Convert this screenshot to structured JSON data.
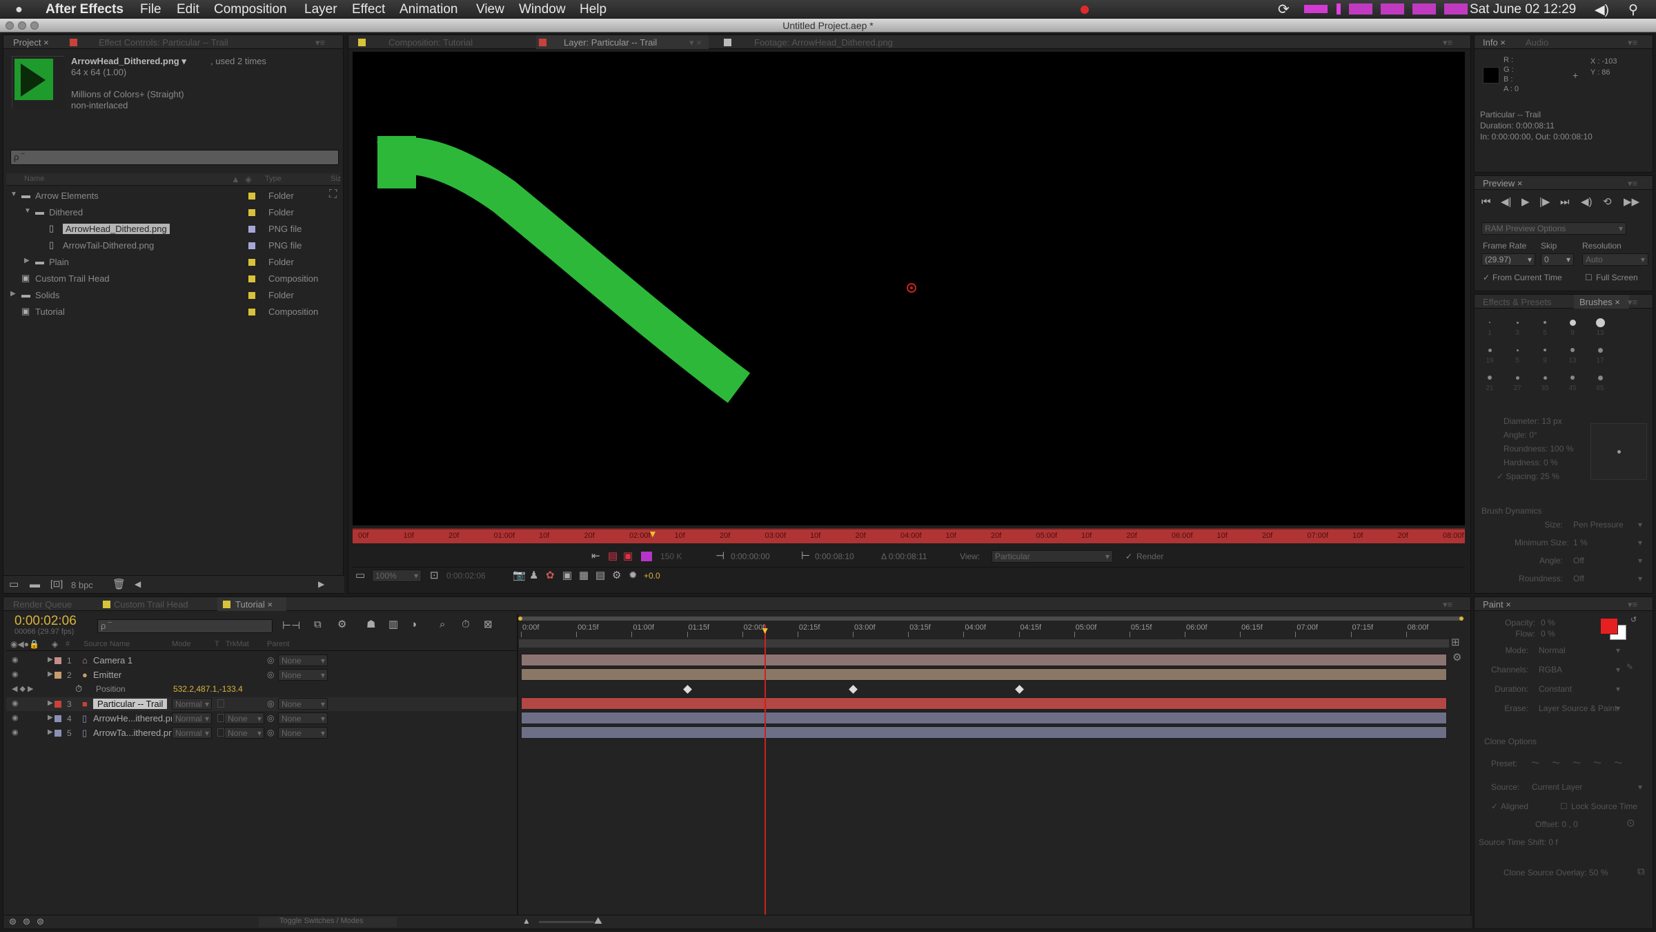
{
  "menubar": {
    "app_name": "After Effects",
    "items": [
      "File",
      "Edit",
      "Composition",
      "Layer",
      "Effect",
      "Animation",
      "View",
      "Window",
      "Help"
    ],
    "clock": "Sat June 02 12:29"
  },
  "window": {
    "title": "Untitled Project.aep *"
  },
  "project_panel": {
    "tabs": [
      "Project ×",
      "Effect Controls: Particular -- Trail"
    ],
    "footage_name": "ArrowHead_Dithered.png ▾",
    "used": ", used 2 times",
    "dims": "64 x 64 (1.00)",
    "colors": "Millions of Colors+ (Straight)",
    "interlace": "non-interlaced",
    "search_placeholder": "ρ ‾",
    "col_name": "Name",
    "col_type": "Type",
    "col_size": "Siz",
    "items": [
      {
        "name": "Arrow Elements",
        "type": "Folder",
        "color": "#d8c23a",
        "indent": 0,
        "twirl": "▼",
        "icon": "folder-icon"
      },
      {
        "name": "Dithered",
        "type": "Folder",
        "color": "#d8c23a",
        "indent": 1,
        "twirl": "▼",
        "icon": "folder-icon"
      },
      {
        "name": "ArrowHead_Dithered.png",
        "type": "PNG file",
        "color": "#a5a6d8",
        "indent": 2,
        "twirl": "",
        "icon": "file-icon",
        "selected": true
      },
      {
        "name": "ArrowTail-Dithered.png",
        "type": "PNG file",
        "color": "#a5a6d8",
        "indent": 2,
        "twirl": "",
        "icon": "file-icon"
      },
      {
        "name": "Plain",
        "type": "Folder",
        "color": "#d8c23a",
        "indent": 1,
        "twirl": "▶",
        "icon": "folder-icon"
      },
      {
        "name": "Custom Trail Head",
        "type": "Composition",
        "color": "#d8c23a",
        "indent": 0,
        "twirl": "",
        "icon": "composition-icon"
      },
      {
        "name": "Solids",
        "type": "Folder",
        "color": "#d8c23a",
        "indent": 0,
        "twirl": "▶",
        "icon": "folder-icon"
      },
      {
        "name": "Tutorial",
        "type": "Composition",
        "color": "#d8c23a",
        "indent": 0,
        "twirl": "",
        "icon": "composition-icon"
      }
    ],
    "bpc": "8 bpc"
  },
  "viewer": {
    "tabs": [
      "Composition: Tutorial",
      "Layer: Particular -- Trail",
      "Footage: ArrowHead_Dithered.png"
    ],
    "mini_ticks": [
      "00f",
      "10f",
      "20f",
      "01:00f",
      "10f",
      "20f",
      "02:00f",
      "10f",
      "20f",
      "03:00f",
      "10f",
      "20f",
      "04:00f",
      "10f",
      "20f",
      "05:00f",
      "10f",
      "20f",
      "06:00f",
      "10f",
      "20f",
      "07:00f",
      "10f",
      "20f",
      "08:00f"
    ],
    "controls": {
      "zoom": "100%",
      "timecode": "0:00:02:06",
      "in_time": "0:00:00:00",
      "out_time": "0:00:08:10",
      "duration": "Δ 0:00:08:11",
      "view_label": "View:",
      "view_value": "Particular",
      "render_label": "Render",
      "exposure": "+0.0",
      "channel": "150 K"
    }
  },
  "info_panel": {
    "tabs": [
      "Info ×",
      "Audio"
    ],
    "rgba": [
      "R :",
      "G :",
      "B :",
      "A : 0"
    ],
    "coords": [
      "X : -103",
      "Y : 86"
    ],
    "layer": "Particular -- Trail",
    "duration": "Duration: 0:00:08:11",
    "inout": "In: 0:00:00:00, Out: 0:00:08:10"
  },
  "preview_panel": {
    "tab": "Preview ×",
    "ram_options": "RAM Preview Options",
    "frame_rate_label": "Frame Rate",
    "skip_label": "Skip",
    "resolution_label": "Resolution",
    "frame_rate": "(29.97)",
    "skip": "0",
    "resolution": "Auto",
    "from_current": "From Current Time",
    "full_screen": "Full Screen"
  },
  "brushes_panel": {
    "tabs": [
      "Effects & Presets",
      "Brushes ×"
    ],
    "brush_sizes": [
      "1",
      "3",
      "5",
      "9",
      "13",
      "19",
      "5",
      "9",
      "13",
      "17",
      "21",
      "27",
      "35",
      "45",
      "65"
    ],
    "props": [
      "Diameter: 13 px",
      "Angle: 0°",
      "Roundness: 100 %",
      "Hardness: 0 %",
      "Spacing: 25 %"
    ],
    "dynamics": "Brush Dynamics",
    "dyn_rows": [
      [
        "Size:",
        "Pen Pressure"
      ],
      [
        "Minimum Size:",
        "1 %"
      ],
      [
        "Angle:",
        "Off"
      ],
      [
        "Roundness:",
        "Off"
      ]
    ]
  },
  "paint_panel": {
    "tab": "Paint ×",
    "fg_color": "#e62020",
    "rows": [
      [
        "Opacity:",
        "0 %"
      ],
      [
        "Flow:",
        "0 %"
      ],
      [
        "Mode:",
        "Normal"
      ],
      [
        "Channels:",
        "RGBA"
      ],
      [
        "Duration:",
        "Constant"
      ],
      [
        "Erase:",
        "Layer Source & Paint"
      ]
    ],
    "clone_options": "Clone Options",
    "preset": "Preset:",
    "source": "Source:",
    "source_value": "Current Layer",
    "aligned": "Aligned",
    "lock_source": "Lock Source Time",
    "offset": "Offset: 0 , 0",
    "source_time_shift": "Source Time Shift: 0 f",
    "clone_overlay": "Clone Source Overlay: 50 %"
  },
  "timeline": {
    "tabs": [
      "Render Queue",
      "Custom Trail Head",
      "Tutorial ×"
    ],
    "timecode": "0:00:02:06",
    "fps": "00066 (29.97 fps)",
    "col_source": "Source Name",
    "col_mode": "Mode",
    "col_t": "T",
    "col_trkmat": "TrkMat",
    "col_parent": "Parent",
    "ruler": [
      "0:00f",
      "00:15f",
      "01:00f",
      "01:15f",
      "02:00f",
      "02:15f",
      "03:00f",
      "03:15f",
      "04:00f",
      "04:15f",
      "05:00f",
      "05:15f",
      "06:00f",
      "06:15f",
      "07:00f",
      "07:15f",
      "08:00f"
    ],
    "layers": [
      {
        "num": "1",
        "name": "Camera 1",
        "color": "#c58d8d",
        "mode": "",
        "trkmat": "",
        "parent": "None",
        "bar": "#8c7472",
        "icon": "camera-icon"
      },
      {
        "num": "2",
        "name": "Emitter",
        "color": "#c79d6e",
        "mode": "",
        "trkmat": "",
        "parent": "None",
        "bar": "#8a7766",
        "icon": "light-icon"
      },
      {
        "num": "",
        "name": "Position",
        "color": "",
        "mode": "",
        "trkmat": "",
        "parent": "",
        "bar": "",
        "icon": "stopwatch-icon",
        "value": "532.2,487.1,-133.4"
      },
      {
        "num": "3",
        "name": "Particular -- Trail",
        "color": "#c8423a",
        "mode": "Normal",
        "trkmat": "",
        "parent": "None",
        "bar": "#b24743",
        "icon": "solid-icon",
        "selected": true
      },
      {
        "num": "4",
        "name": "ArrowHe...ithered.png",
        "color": "#8c8fb8",
        "mode": "Normal",
        "trkmat": "None",
        "parent": "None",
        "bar": "#6c6f86",
        "icon": "file-icon"
      },
      {
        "num": "5",
        "name": "ArrowTa...ithered.png",
        "color": "#8c8fb8",
        "mode": "Normal",
        "trkmat": "None",
        "parent": "None",
        "bar": "#6c6f86",
        "icon": "file-icon"
      }
    ],
    "keyframes_seconds": [
      1.5,
      3.0,
      4.5
    ],
    "playhead_seconds": 2.2,
    "duration_seconds": 8.37,
    "toggle_label": "Toggle Switches / Modes"
  },
  "colors": {
    "accent": "#f0c030",
    "playhead": "#d02020",
    "stroke": "#2db83a"
  }
}
